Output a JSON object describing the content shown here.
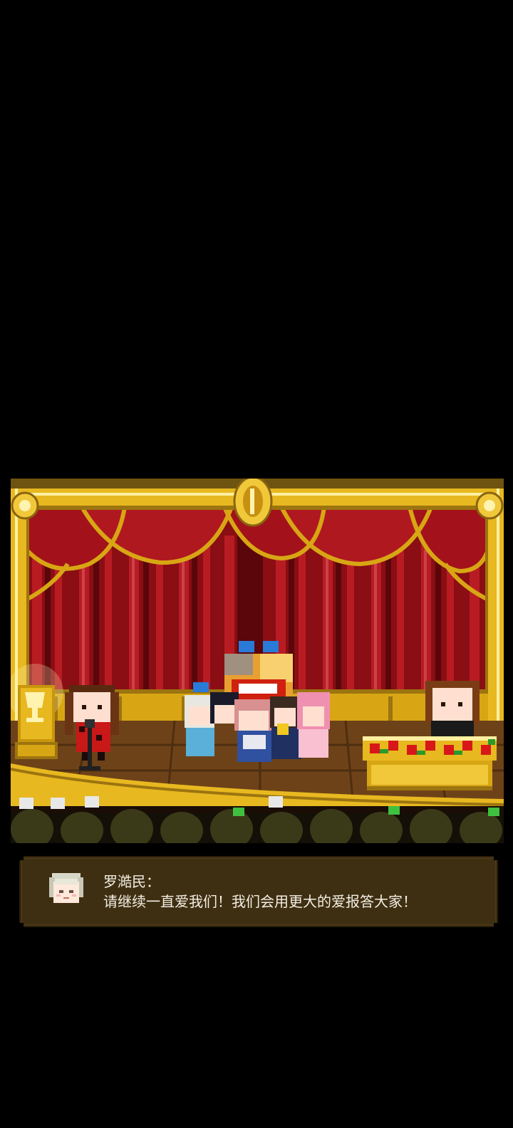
{
  "scene": {
    "setting": "theater stage with red curtains and gold frame",
    "colors": {
      "curtain": "#9c1016",
      "gold": "#d8a614",
      "stage_floor": "#7a4a1a",
      "dialog_bg": "#3f2f12",
      "dialog_text": "#f3efe4"
    },
    "icons": [
      "trophy-icon",
      "microphone-stand-icon",
      "flower-box-icon",
      "crown-emblem-icon"
    ]
  },
  "dialog": {
    "speaker": "罗澔民：",
    "text": "请继续一直爱我们！我们会用更大的爱报答大家！",
    "avatar_icon": "speaker-avatar-icon"
  }
}
